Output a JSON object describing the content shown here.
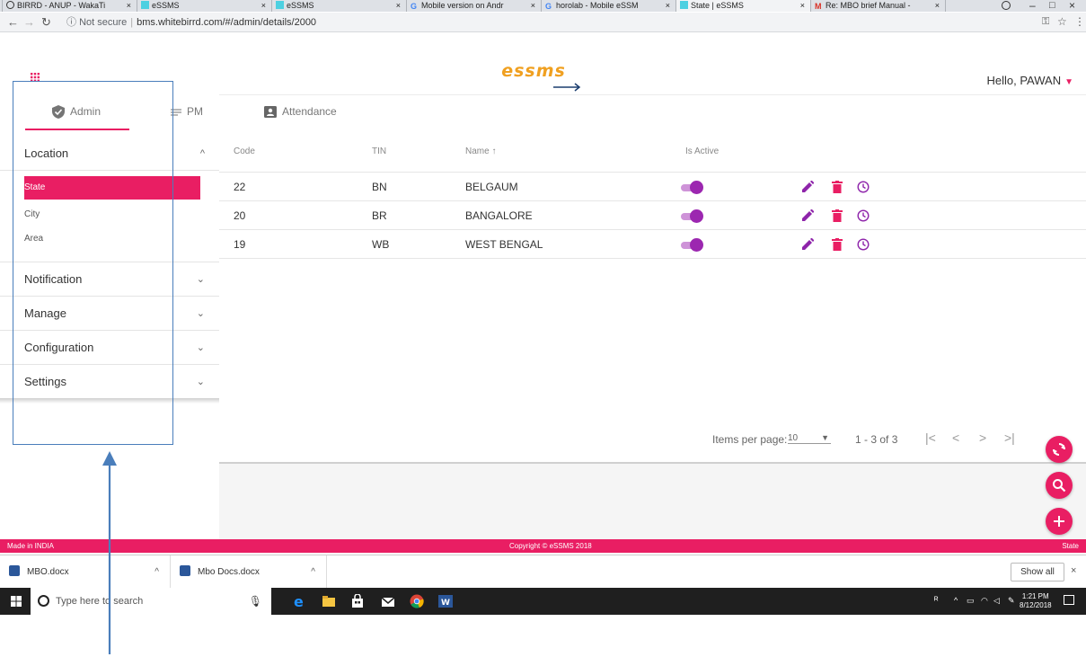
{
  "browser": {
    "tabs": [
      {
        "title": "BIRRD - ANUP - WakaTi",
        "icon": "clock-favicon"
      },
      {
        "title": "eSSMS",
        "icon": "essms-favicon"
      },
      {
        "title": "eSSMS",
        "icon": "essms-favicon"
      },
      {
        "title": "Mobile version on Andr",
        "icon": "google-favicon"
      },
      {
        "title": "horolab - Mobile eSSM",
        "icon": "google-favicon"
      },
      {
        "title": "State | eSSMS",
        "icon": "essms-favicon",
        "active": true
      },
      {
        "title": "Re: MBO brief Manual -",
        "icon": "gmail-favicon"
      }
    ],
    "tab_close": "×",
    "window_min": "–",
    "window_max": "□",
    "window_close": "×",
    "url_security": "Not secure",
    "url": "bms.whitebirrd.com/#/admin/details/2000"
  },
  "header": {
    "logo_text": "essms",
    "greeting": "Hello, PAWAN",
    "caret": "▼"
  },
  "top_tabs": [
    {
      "label": "Admin",
      "icon": "shield-check-icon"
    },
    {
      "label": "PM",
      "icon": "list-icon"
    },
    {
      "label": "Attendance",
      "icon": "contact-card-icon"
    }
  ],
  "sidebar": {
    "location": {
      "label": "Location",
      "chevron": "^"
    },
    "location_items": [
      "State",
      "City",
      "Area"
    ],
    "sections": [
      {
        "label": "Notification",
        "chevron": "⌄"
      },
      {
        "label": "Manage",
        "chevron": "⌄"
      },
      {
        "label": "Configuration",
        "chevron": "⌄"
      },
      {
        "label": "Settings",
        "chevron": "⌄"
      }
    ]
  },
  "table": {
    "headers": {
      "code": "Code",
      "tin": "TIN",
      "name": "Name",
      "sort_arrow": "↑",
      "active": "Is Active"
    },
    "rows": [
      {
        "code": "22",
        "tin": "BN",
        "name": "BELGAUM",
        "active": true
      },
      {
        "code": "20",
        "tin": "BR",
        "name": "BANGALORE",
        "active": true
      },
      {
        "code": "19",
        "tin": "WB",
        "name": "WEST BENGAL",
        "active": true
      }
    ]
  },
  "paginator": {
    "label": "Items per page:",
    "page_size": "10",
    "range": "1 - 3 of 3",
    "first": "|<",
    "prev": "<",
    "next": ">",
    "last": ">|"
  },
  "footer": {
    "left": "Made in INDIA",
    "center": "Copyright © eSSMS 2018",
    "right": "State"
  },
  "downloads": {
    "items": [
      {
        "name": "MBO.docx",
        "arrow": "^"
      },
      {
        "name": "Mbo Docs.docx",
        "arrow": "^"
      }
    ],
    "show_all": "Show all",
    "close": "×"
  },
  "taskbar": {
    "search_placeholder": "Type here to search",
    "time": "1:21 PM",
    "date": "8/12/2018"
  },
  "colors": {
    "accent": "#e91e63",
    "toggle": "#9c27b0",
    "edit": "#8e24aa",
    "delete": "#e91e63",
    "annotation": "#4a7ebb"
  }
}
